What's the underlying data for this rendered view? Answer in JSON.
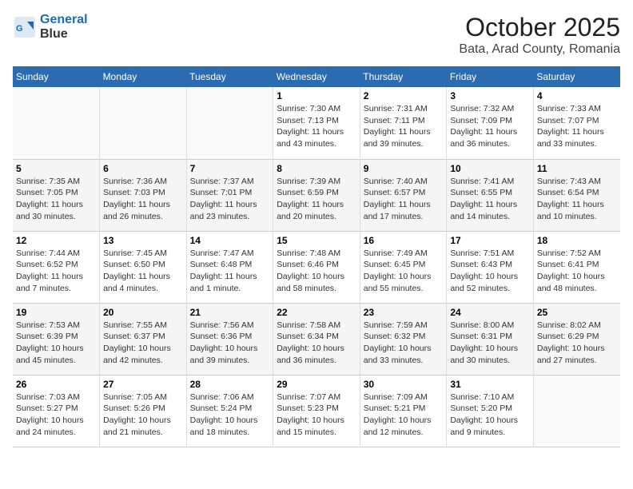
{
  "header": {
    "logo_line1": "General",
    "logo_line2": "Blue",
    "title": "October 2025",
    "subtitle": "Bata, Arad County, Romania"
  },
  "days_of_week": [
    "Sunday",
    "Monday",
    "Tuesday",
    "Wednesday",
    "Thursday",
    "Friday",
    "Saturday"
  ],
  "weeks": [
    [
      {
        "day": "",
        "info": ""
      },
      {
        "day": "",
        "info": ""
      },
      {
        "day": "",
        "info": ""
      },
      {
        "day": "1",
        "info": "Sunrise: 7:30 AM\nSunset: 7:13 PM\nDaylight: 11 hours and 43 minutes."
      },
      {
        "day": "2",
        "info": "Sunrise: 7:31 AM\nSunset: 7:11 PM\nDaylight: 11 hours and 39 minutes."
      },
      {
        "day": "3",
        "info": "Sunrise: 7:32 AM\nSunset: 7:09 PM\nDaylight: 11 hours and 36 minutes."
      },
      {
        "day": "4",
        "info": "Sunrise: 7:33 AM\nSunset: 7:07 PM\nDaylight: 11 hours and 33 minutes."
      }
    ],
    [
      {
        "day": "5",
        "info": "Sunrise: 7:35 AM\nSunset: 7:05 PM\nDaylight: 11 hours and 30 minutes."
      },
      {
        "day": "6",
        "info": "Sunrise: 7:36 AM\nSunset: 7:03 PM\nDaylight: 11 hours and 26 minutes."
      },
      {
        "day": "7",
        "info": "Sunrise: 7:37 AM\nSunset: 7:01 PM\nDaylight: 11 hours and 23 minutes."
      },
      {
        "day": "8",
        "info": "Sunrise: 7:39 AM\nSunset: 6:59 PM\nDaylight: 11 hours and 20 minutes."
      },
      {
        "day": "9",
        "info": "Sunrise: 7:40 AM\nSunset: 6:57 PM\nDaylight: 11 hours and 17 minutes."
      },
      {
        "day": "10",
        "info": "Sunrise: 7:41 AM\nSunset: 6:55 PM\nDaylight: 11 hours and 14 minutes."
      },
      {
        "day": "11",
        "info": "Sunrise: 7:43 AM\nSunset: 6:54 PM\nDaylight: 11 hours and 10 minutes."
      }
    ],
    [
      {
        "day": "12",
        "info": "Sunrise: 7:44 AM\nSunset: 6:52 PM\nDaylight: 11 hours and 7 minutes."
      },
      {
        "day": "13",
        "info": "Sunrise: 7:45 AM\nSunset: 6:50 PM\nDaylight: 11 hours and 4 minutes."
      },
      {
        "day": "14",
        "info": "Sunrise: 7:47 AM\nSunset: 6:48 PM\nDaylight: 11 hours and 1 minute."
      },
      {
        "day": "15",
        "info": "Sunrise: 7:48 AM\nSunset: 6:46 PM\nDaylight: 10 hours and 58 minutes."
      },
      {
        "day": "16",
        "info": "Sunrise: 7:49 AM\nSunset: 6:45 PM\nDaylight: 10 hours and 55 minutes."
      },
      {
        "day": "17",
        "info": "Sunrise: 7:51 AM\nSunset: 6:43 PM\nDaylight: 10 hours and 52 minutes."
      },
      {
        "day": "18",
        "info": "Sunrise: 7:52 AM\nSunset: 6:41 PM\nDaylight: 10 hours and 48 minutes."
      }
    ],
    [
      {
        "day": "19",
        "info": "Sunrise: 7:53 AM\nSunset: 6:39 PM\nDaylight: 10 hours and 45 minutes."
      },
      {
        "day": "20",
        "info": "Sunrise: 7:55 AM\nSunset: 6:37 PM\nDaylight: 10 hours and 42 minutes."
      },
      {
        "day": "21",
        "info": "Sunrise: 7:56 AM\nSunset: 6:36 PM\nDaylight: 10 hours and 39 minutes."
      },
      {
        "day": "22",
        "info": "Sunrise: 7:58 AM\nSunset: 6:34 PM\nDaylight: 10 hours and 36 minutes."
      },
      {
        "day": "23",
        "info": "Sunrise: 7:59 AM\nSunset: 6:32 PM\nDaylight: 10 hours and 33 minutes."
      },
      {
        "day": "24",
        "info": "Sunrise: 8:00 AM\nSunset: 6:31 PM\nDaylight: 10 hours and 30 minutes."
      },
      {
        "day": "25",
        "info": "Sunrise: 8:02 AM\nSunset: 6:29 PM\nDaylight: 10 hours and 27 minutes."
      }
    ],
    [
      {
        "day": "26",
        "info": "Sunrise: 7:03 AM\nSunset: 5:27 PM\nDaylight: 10 hours and 24 minutes."
      },
      {
        "day": "27",
        "info": "Sunrise: 7:05 AM\nSunset: 5:26 PM\nDaylight: 10 hours and 21 minutes."
      },
      {
        "day": "28",
        "info": "Sunrise: 7:06 AM\nSunset: 5:24 PM\nDaylight: 10 hours and 18 minutes."
      },
      {
        "day": "29",
        "info": "Sunrise: 7:07 AM\nSunset: 5:23 PM\nDaylight: 10 hours and 15 minutes."
      },
      {
        "day": "30",
        "info": "Sunrise: 7:09 AM\nSunset: 5:21 PM\nDaylight: 10 hours and 12 minutes."
      },
      {
        "day": "31",
        "info": "Sunrise: 7:10 AM\nSunset: 5:20 PM\nDaylight: 10 hours and 9 minutes."
      },
      {
        "day": "",
        "info": ""
      }
    ]
  ]
}
